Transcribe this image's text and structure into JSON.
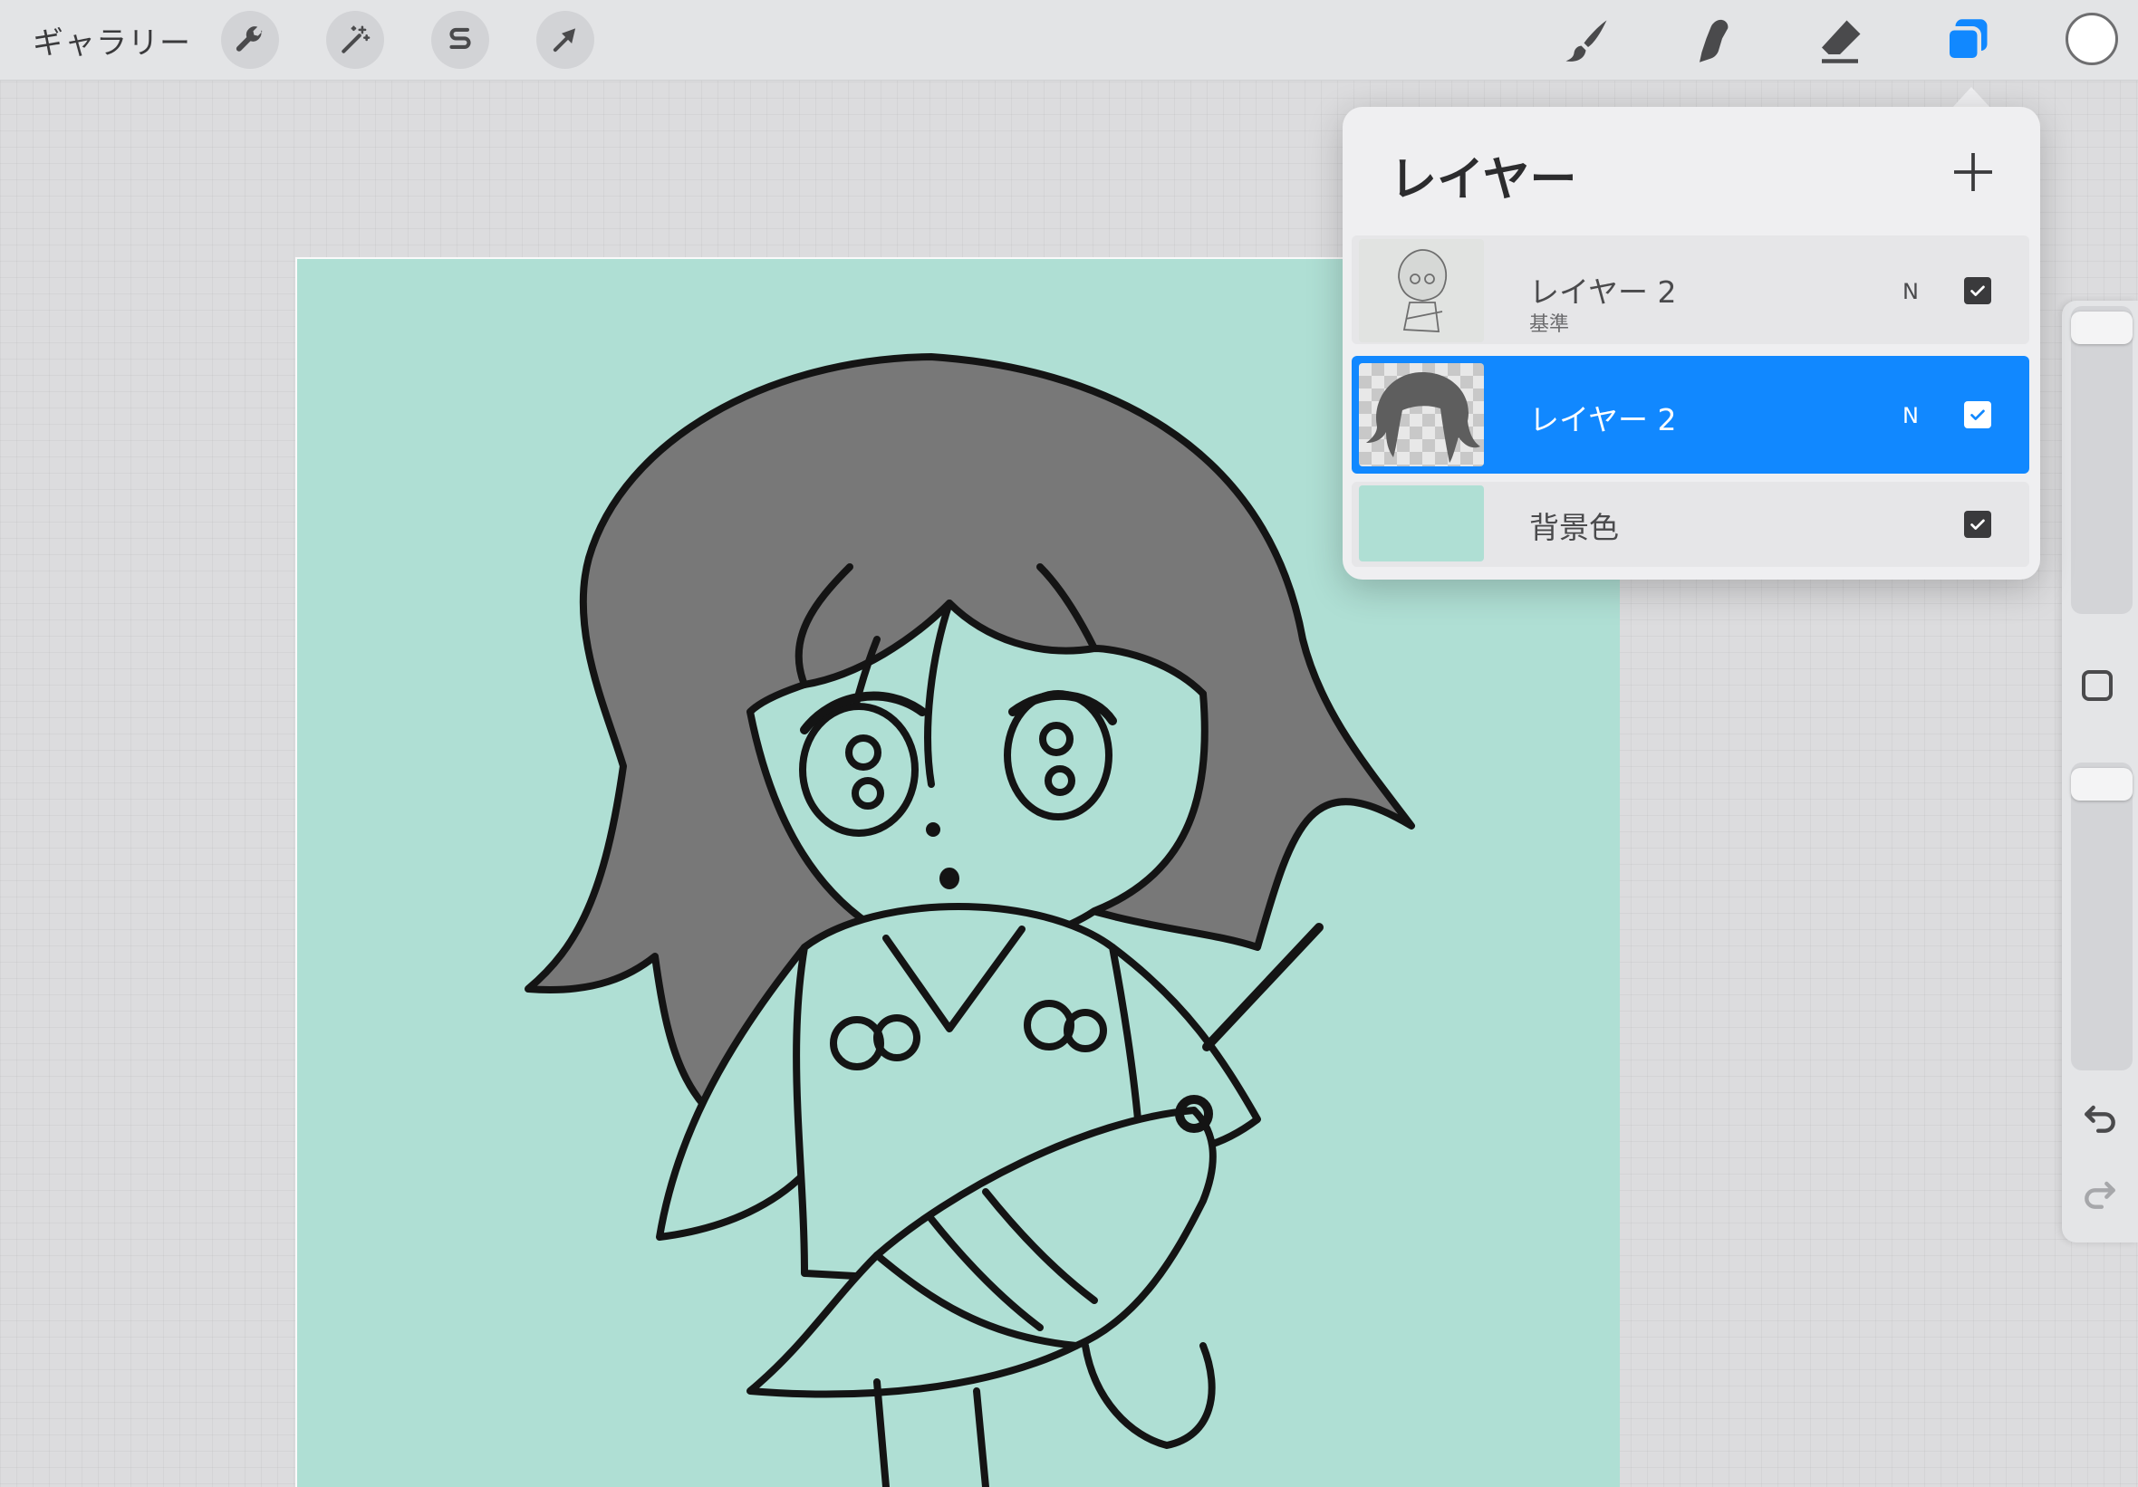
{
  "topbar": {
    "gallery_label": "ギャラリー",
    "actions_icon": "wrench-icon",
    "adjustments_icon": "magic-wand-icon",
    "selection_icon": "selection-s-icon",
    "transform_icon": "arrow-cursor-icon",
    "brush_icon": "brush-icon",
    "smudge_icon": "smudge-icon",
    "eraser_icon": "eraser-icon",
    "layers_icon": "layers-icon",
    "active_color": "#ffffff",
    "accent_color": "#1188ff"
  },
  "layers": {
    "title": "レイヤー",
    "add_icon": "plus-icon",
    "items": [
      {
        "name": "レイヤー 2",
        "sublabel": "基準",
        "blend": "N",
        "visible": true,
        "selected": false
      },
      {
        "name": "レイヤー 2",
        "blend": "N",
        "visible": true,
        "selected": true
      },
      {
        "name": "背景色",
        "visible": true,
        "selected": false
      }
    ]
  },
  "canvas": {
    "background_color": "#afdfd4"
  }
}
